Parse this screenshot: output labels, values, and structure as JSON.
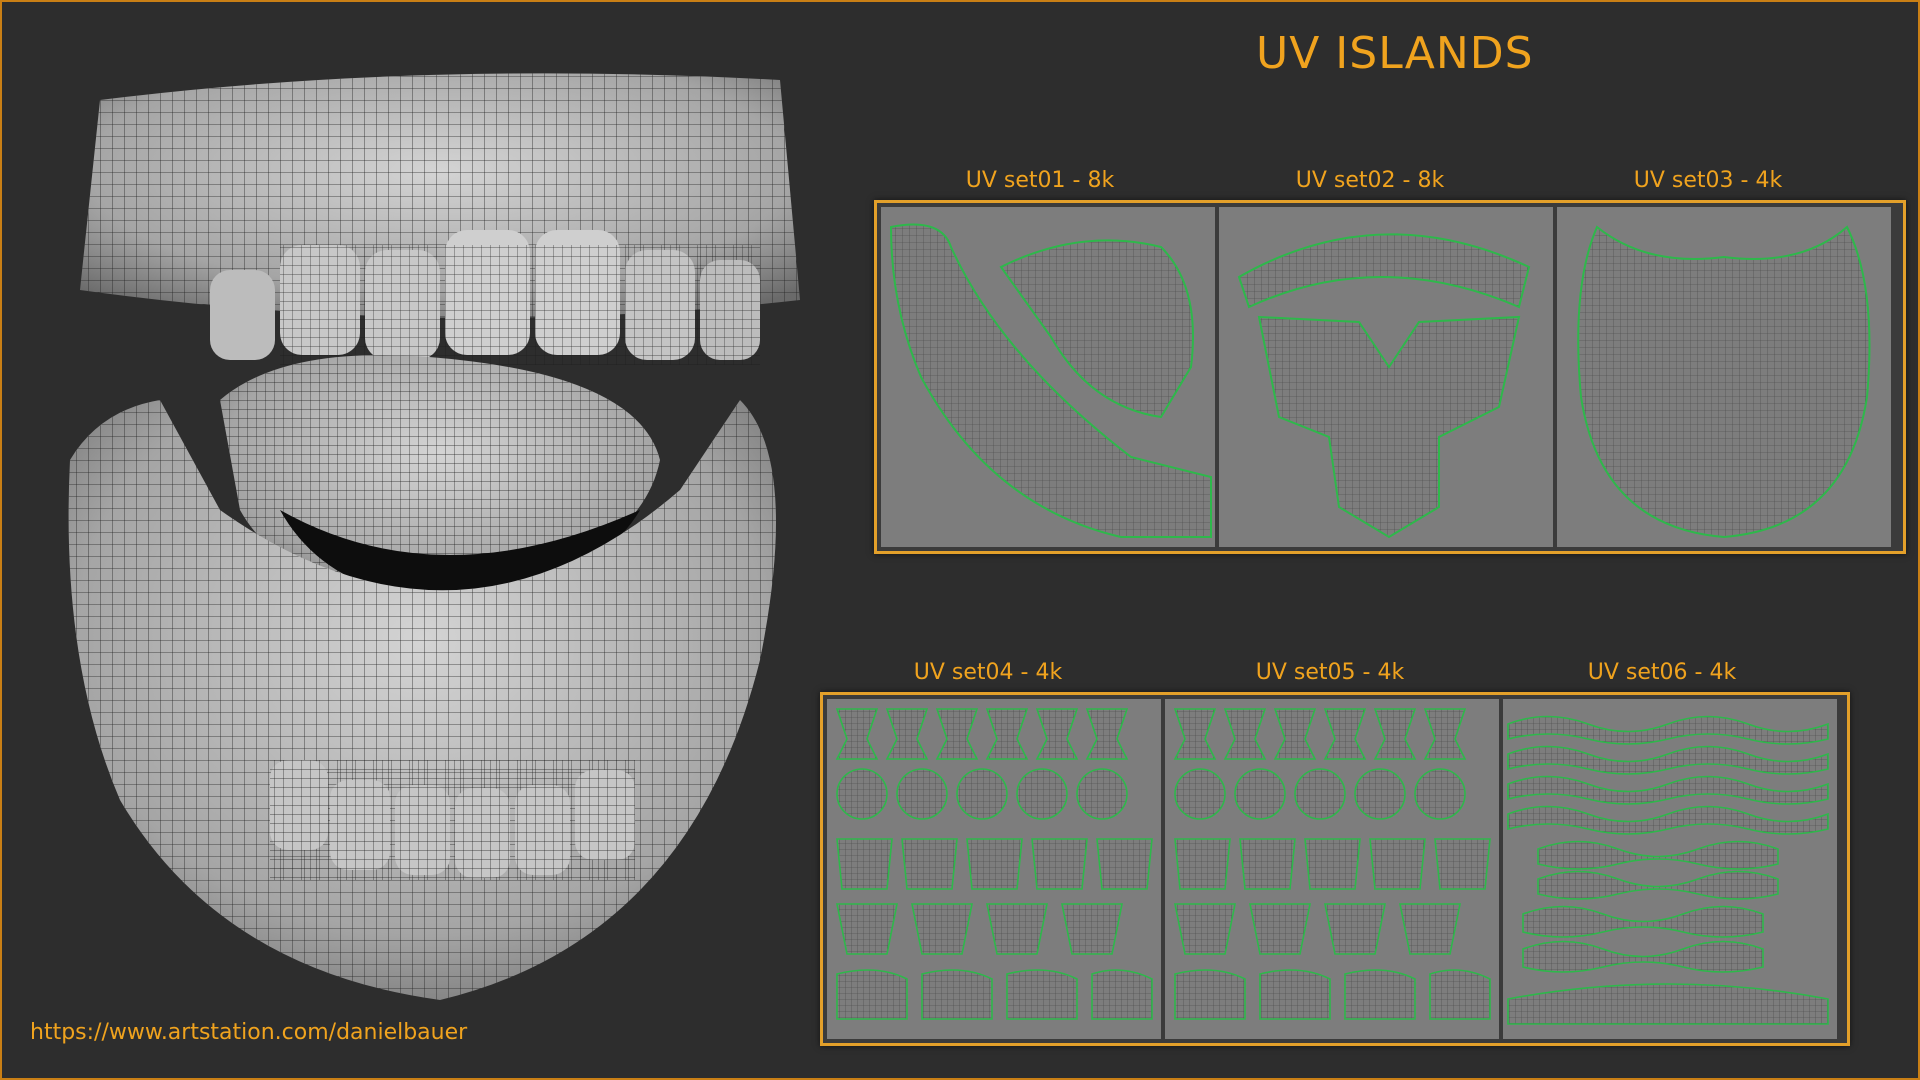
{
  "title": "UV ISLANDS",
  "url": "https://www.artstation.com/danielbauer",
  "accent_color": "#f0a31e",
  "uv_row1": [
    "UV set01 - 8k",
    "UV set02 - 8k",
    "UV set03 - 4k"
  ],
  "uv_row2": [
    "UV set04 - 4k",
    "UV set05 - 4k",
    "UV set06 - 4k"
  ]
}
